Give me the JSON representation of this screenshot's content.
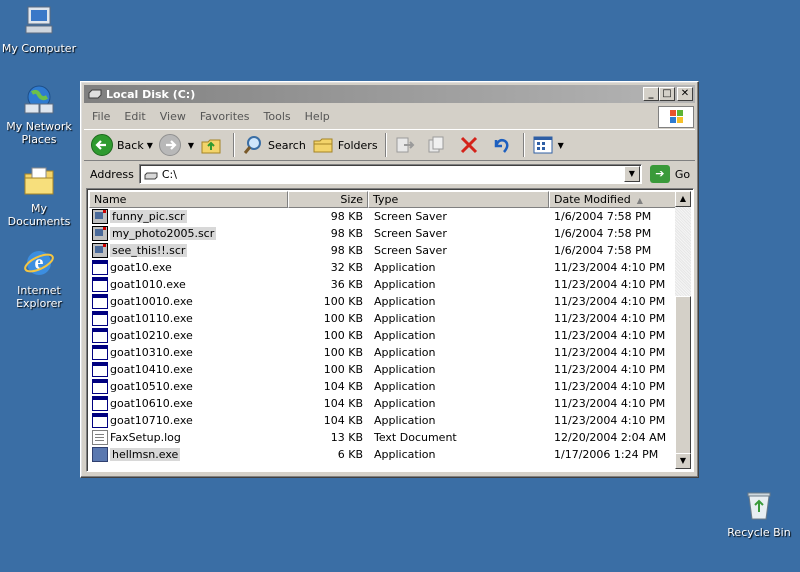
{
  "desktop": {
    "icons": [
      {
        "label": "My Computer",
        "icon": "my-computer-icon"
      },
      {
        "label": "My Network Places",
        "icon": "network-places-icon"
      },
      {
        "label": "My Documents",
        "icon": "my-documents-icon"
      },
      {
        "label": "Internet Explorer",
        "icon": "internet-explorer-icon"
      },
      {
        "label": "Recycle Bin",
        "icon": "recycle-bin-icon"
      }
    ]
  },
  "window": {
    "title": "Local Disk (C:)",
    "menu": [
      "File",
      "Edit",
      "View",
      "Favorites",
      "Tools",
      "Help"
    ],
    "toolbar": {
      "back": "Back",
      "search": "Search",
      "folders": "Folders"
    },
    "address": {
      "label": "Address",
      "value": "C:\\",
      "go": "Go"
    },
    "columns": {
      "name": "Name",
      "size": "Size",
      "type": "Type",
      "date": "Date Modified"
    },
    "files": [
      {
        "name": "funny_pic.scr",
        "size": "98 KB",
        "type": "Screen Saver",
        "date": "1/6/2004 7:58 PM",
        "icon": "screensaver-icon",
        "highlight": true
      },
      {
        "name": "my_photo2005.scr",
        "size": "98 KB",
        "type": "Screen Saver",
        "date": "1/6/2004 7:58 PM",
        "icon": "screensaver-icon",
        "highlight": true
      },
      {
        "name": "see_this!!.scr",
        "size": "98 KB",
        "type": "Screen Saver",
        "date": "1/6/2004 7:58 PM",
        "icon": "screensaver-icon",
        "highlight": true
      },
      {
        "name": "goat10.exe",
        "size": "32 KB",
        "type": "Application",
        "date": "11/23/2004 4:10 PM",
        "icon": "application-icon",
        "highlight": false
      },
      {
        "name": "goat1010.exe",
        "size": "36 KB",
        "type": "Application",
        "date": "11/23/2004 4:10 PM",
        "icon": "application-icon",
        "highlight": false
      },
      {
        "name": "goat10010.exe",
        "size": "100 KB",
        "type": "Application",
        "date": "11/23/2004 4:10 PM",
        "icon": "application-icon",
        "highlight": false
      },
      {
        "name": "goat10110.exe",
        "size": "100 KB",
        "type": "Application",
        "date": "11/23/2004 4:10 PM",
        "icon": "application-icon",
        "highlight": false
      },
      {
        "name": "goat10210.exe",
        "size": "100 KB",
        "type": "Application",
        "date": "11/23/2004 4:10 PM",
        "icon": "application-icon",
        "highlight": false
      },
      {
        "name": "goat10310.exe",
        "size": "100 KB",
        "type": "Application",
        "date": "11/23/2004 4:10 PM",
        "icon": "application-icon",
        "highlight": false
      },
      {
        "name": "goat10410.exe",
        "size": "100 KB",
        "type": "Application",
        "date": "11/23/2004 4:10 PM",
        "icon": "application-icon",
        "highlight": false
      },
      {
        "name": "goat10510.exe",
        "size": "104 KB",
        "type": "Application",
        "date": "11/23/2004 4:10 PM",
        "icon": "application-icon",
        "highlight": false
      },
      {
        "name": "goat10610.exe",
        "size": "104 KB",
        "type": "Application",
        "date": "11/23/2004 4:10 PM",
        "icon": "application-icon",
        "highlight": false
      },
      {
        "name": "goat10710.exe",
        "size": "104 KB",
        "type": "Application",
        "date": "11/23/2004 4:10 PM",
        "icon": "application-icon",
        "highlight": false
      },
      {
        "name": "FaxSetup.log",
        "size": "13 KB",
        "type": "Text Document",
        "date": "12/20/2004 2:04 AM",
        "icon": "text-document-icon",
        "highlight": false
      },
      {
        "name": "hellmsn.exe",
        "size": "6 KB",
        "type": "Application",
        "date": "1/17/2006 1:24 PM",
        "icon": "hellmsn-app-icon",
        "highlight": true
      }
    ]
  },
  "colors": {
    "desktop": "#3a6ea5",
    "inactive_title_start": "#808080",
    "inactive_title_end": "#b5b5b5",
    "window_face": "#d4d0c8"
  }
}
